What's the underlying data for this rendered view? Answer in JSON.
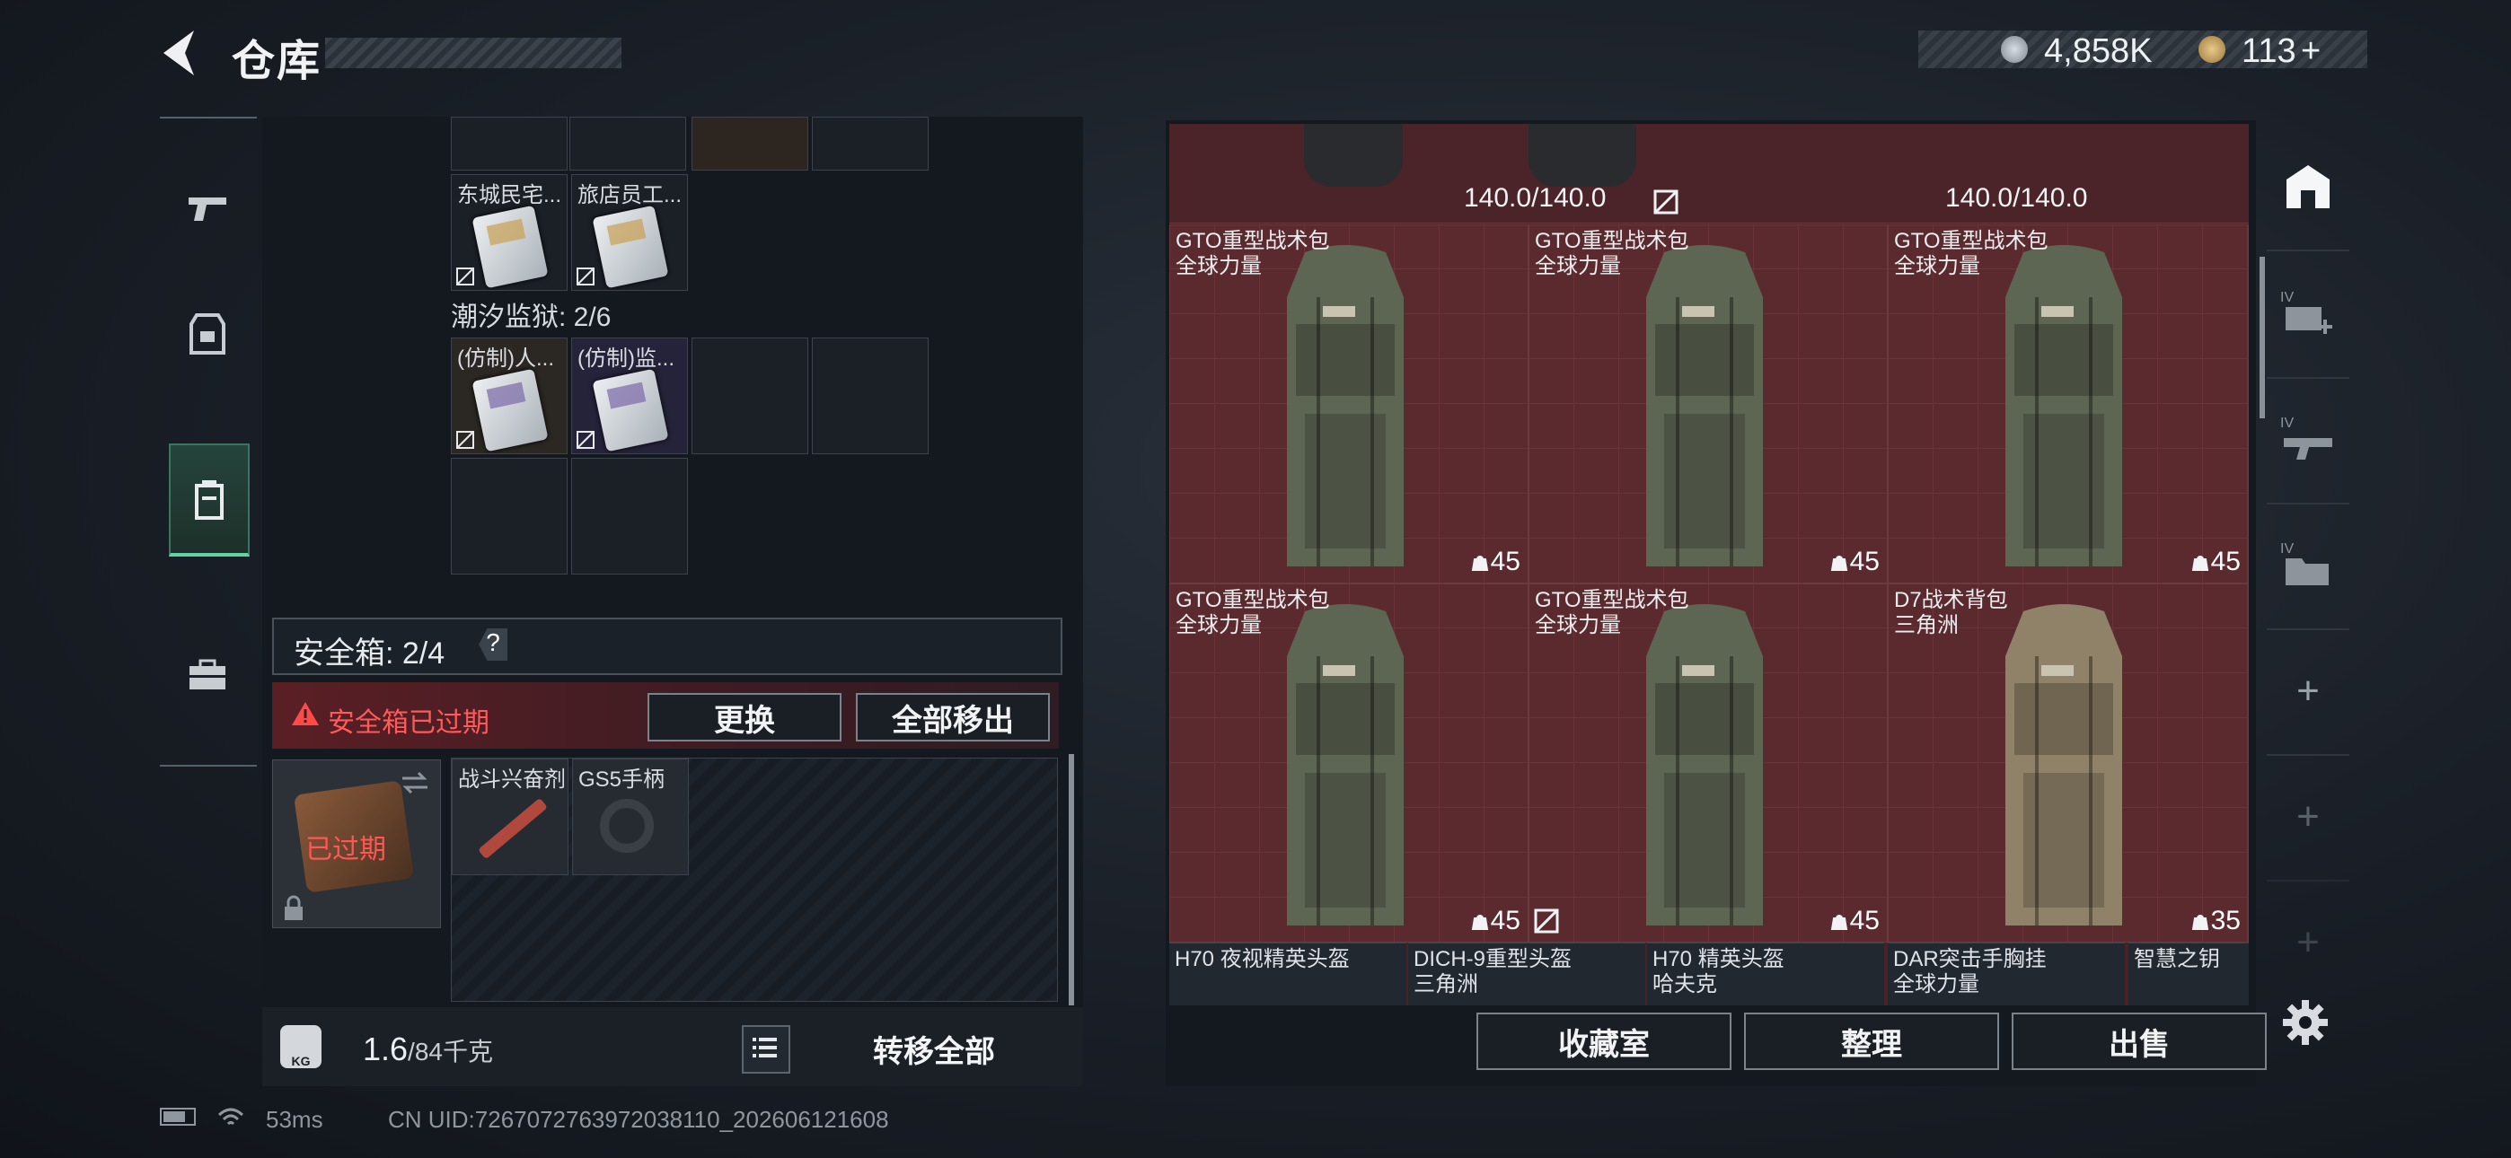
{
  "header": {
    "title": "仓库",
    "currency_1": "4,858K",
    "currency_2": "113",
    "add_symbol": "+"
  },
  "left": {
    "top_row_labels": [
      "东城民宅...",
      "旅店员工..."
    ],
    "prison_label": "潮汐监狱: 2/6",
    "prison_items": [
      "(仿制)人...",
      "(仿制)监..."
    ],
    "safe_box_title": "安全箱: 2/4",
    "safe_box_help": "?",
    "expired_msg": "安全箱已过期",
    "replace_button": "更换",
    "move_all_button": "全部移出",
    "safebox_status": "已过期",
    "safe_items": [
      "战斗兴奋剂",
      "GS5手柄"
    ],
    "weight_current": "1.6",
    "weight_total": "/84千克",
    "weight_icon_label": "KG",
    "transfer_all_button": "转移全部"
  },
  "stash": {
    "durability_1": "140.0/140.0",
    "durability_2": "140.0/140.0",
    "backpacks": [
      {
        "name": "GTO重型战术包",
        "faction": "全球力量",
        "count": "45",
        "color": "#5d6553"
      },
      {
        "name": "GTO重型战术包",
        "faction": "全球力量",
        "count": "45",
        "color": "#5d6553"
      },
      {
        "name": "GTO重型战术包",
        "faction": "全球力量",
        "count": "45",
        "color": "#5d6553"
      },
      {
        "name": "GTO重型战术包",
        "faction": "全球力量",
        "count": "45",
        "color": "#5d6553"
      },
      {
        "name": "GTO重型战术包",
        "faction": "全球力量",
        "count": "45",
        "color": "#5d6553"
      },
      {
        "name": "D7战术背包",
        "faction": "三角洲",
        "count": "35",
        "color": "#8f8268"
      }
    ],
    "bottom_items": [
      {
        "name": "H70 夜视精英头盔",
        "faction": ""
      },
      {
        "name": "DICH-9重型头盔",
        "faction": "三角洲"
      },
      {
        "name": "H70 精英头盔",
        "faction": "哈夫克"
      },
      {
        "name": "DAR突击手胸挂",
        "faction": "全球力量"
      },
      {
        "name": "智慧之钥",
        "faction": ""
      }
    ],
    "collection_button": "收藏室",
    "organize_button": "整理",
    "sell_button": "出售"
  },
  "side_nav": {
    "plus": "+",
    "tier": "IV"
  },
  "status": {
    "ping": "53ms",
    "uid": "CN UID:7267072763972038110_202606121608"
  },
  "colors": {
    "accent_green": "#5fd3a6",
    "alert_red": "#ff5a5a",
    "stash_red": "#5a2a2f"
  }
}
